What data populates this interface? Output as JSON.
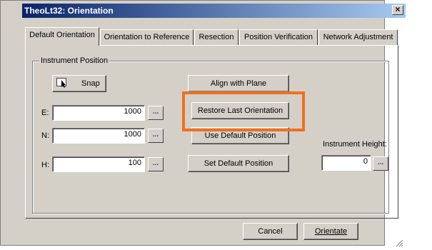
{
  "window": {
    "title": "TheoLt32: Orientation",
    "close_label": "×"
  },
  "tabs": [
    {
      "label": "Default Orientation",
      "active": true
    },
    {
      "label": "Orientation to Reference"
    },
    {
      "label": "Resection"
    },
    {
      "label": "Position Verification"
    },
    {
      "label": "Network Adjustment"
    }
  ],
  "group": {
    "label": "Instrument Position"
  },
  "snap": {
    "label": "Snap",
    "icon": "cursor-icon"
  },
  "fields": {
    "e": {
      "label": "E:",
      "value": "1000"
    },
    "n": {
      "label": "N:",
      "value": "1000"
    },
    "h": {
      "label": "H:",
      "value": "100"
    }
  },
  "browse_label": "...",
  "buttons": {
    "align": "Align with Plane",
    "restore": "Restore Last Orientation",
    "use_default": "Use Default Position",
    "set_default": "Set Default Position"
  },
  "instrument_height": {
    "label": "Instrument Height:",
    "value": "0"
  },
  "footer": {
    "cancel": "Cancel",
    "orientate": "Orientate"
  }
}
